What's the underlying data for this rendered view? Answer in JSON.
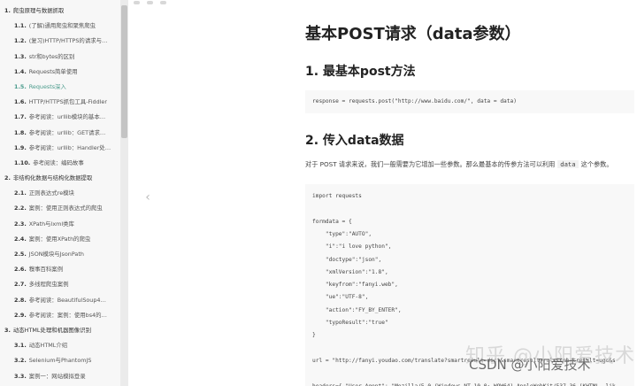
{
  "sidebar": {
    "items": [
      {
        "num": "1.",
        "label": "爬虫原理与数据抓取",
        "level": 1
      },
      {
        "num": "1.1.",
        "label": "(了解)通用爬虫和聚焦爬虫",
        "level": 2
      },
      {
        "num": "1.2.",
        "label": "(复习)HTTP/HTTPS的请求与…",
        "level": 2
      },
      {
        "num": "1.3.",
        "label": "str和bytes的区别",
        "level": 2
      },
      {
        "num": "1.4.",
        "label": "Requests简单使用",
        "level": 2
      },
      {
        "num": "1.5.",
        "label": "Requests深入",
        "level": 2,
        "active": true
      },
      {
        "num": "1.6.",
        "label": "HTTP/HTTPS抓包工具-Fiddler",
        "level": 2
      },
      {
        "num": "1.7.",
        "label": "参考阅读：urllib模块的基本…",
        "level": 2
      },
      {
        "num": "1.8.",
        "label": "参考阅读：urllib：GET请求…",
        "level": 2
      },
      {
        "num": "1.9.",
        "label": "参考阅读：urllib：Handler处…",
        "level": 2
      },
      {
        "num": "1.10.",
        "label": "参考阅读：编码故事",
        "level": 2
      },
      {
        "num": "2.",
        "label": "非结构化数据与结构化数据提取",
        "level": 1
      },
      {
        "num": "2.1.",
        "label": "正则表达式re模块",
        "level": 2
      },
      {
        "num": "2.2.",
        "label": "案例：使用正则表达式的爬虫",
        "level": 2
      },
      {
        "num": "2.3.",
        "label": "XPath与lxml类库",
        "level": 2
      },
      {
        "num": "2.4.",
        "label": "案例：使用XPath的爬虫",
        "level": 2
      },
      {
        "num": "2.5.",
        "label": "JSON模块与JsonPath",
        "level": 2
      },
      {
        "num": "2.6.",
        "label": "糗事百科案例",
        "level": 2
      },
      {
        "num": "2.7.",
        "label": "多线程爬虫案例",
        "level": 2
      },
      {
        "num": "2.8.",
        "label": "参考阅读：BeautifulSoup4…",
        "level": 2
      },
      {
        "num": "2.9.",
        "label": "参考阅读：案例：使用bs4的…",
        "level": 2
      },
      {
        "num": "3.",
        "label": "动态HTML处理和机器图像识别",
        "level": 1
      },
      {
        "num": "3.1.",
        "label": "动态HTML介绍",
        "level": 2
      },
      {
        "num": "3.2.",
        "label": "Selenium与PhantomJS",
        "level": 2
      },
      {
        "num": "3.3.",
        "label": "案例一：网站模拟登录",
        "level": 2
      }
    ]
  },
  "nav": {
    "prev_icon": "‹"
  },
  "content": {
    "title": "基本POST请求（data参数）",
    "sections": [
      {
        "heading": "1. 最基本post方法"
      },
      {
        "heading": "2. 传入data数据"
      }
    ],
    "code1": "response = requests.post(\"http://www.baidu.com/\", data = data)",
    "paragraph_before": "对于 POST 请求来说，我们一般需要为它增加一些参数。那么最基本的传参方法可以利用",
    "paragraph_code": "data",
    "paragraph_after": "这个参数。",
    "code2": [
      "import requests",
      "",
      "formdata = {",
      "    \"type\":\"AUTO\",",
      "    \"i\":\"i love python\",",
      "    \"doctype\":\"json\",",
      "    \"xmlVersion\":\"1.8\",",
      "    \"keyfrom\":\"fanyi.web\",",
      "    \"ue\":\"UTF-8\",",
      "    \"action\":\"FY_BY_ENTER\",",
      "    \"typoResult\":\"true\"",
      "}",
      "",
      "url = \"http://fanyi.youdao.com/translate?smartresult=dict&smartresult=rule&smartresult=ugc&s",
      "",
      "headers={ \"User-Agent\": \"Mozilla/5.0 (Windows NT 10.0; WOW64) AppleWebKit/537.36 (KHTML, lik"
    ]
  },
  "watermark": {
    "zhihu": "知乎 @小阳爱技术",
    "csdn": "CSDN @小阳爱技术"
  }
}
